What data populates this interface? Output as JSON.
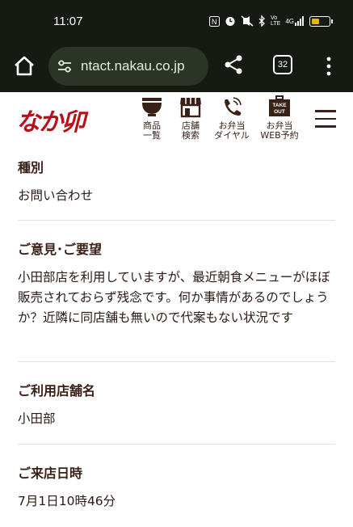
{
  "status": {
    "time": "11:07",
    "network": "4G"
  },
  "browser": {
    "url": "ntact.nakau.co.jp",
    "tab_count": "32"
  },
  "site": {
    "logo": "なか卯",
    "nav": [
      {
        "line1": "商品",
        "line2": "一覧"
      },
      {
        "line1": "店舗",
        "line2": "検索"
      },
      {
        "line1": "お弁当",
        "line2": "ダイヤル"
      },
      {
        "line1": "お弁当",
        "line2": "WEB予約"
      }
    ],
    "takeout_icon_text": [
      "TAKE",
      "OUT"
    ]
  },
  "form": {
    "type_label": "種別",
    "type_value": "お問い合わせ",
    "opinion_label": "ご意見･ご要望",
    "opinion_value": "小田部店を利用していますが、最近朝食メニューがほぼ販売されておらず残念です。何か事情があるのでしょうか？近隣に同店舗も無いので代案もない状況です",
    "store_label": "ご利用店舗名",
    "store_value": "小田部",
    "visit_label": "ご来店日時",
    "visit_value": "7月1日10時46分"
  },
  "colors": {
    "bar": "#151a12",
    "pill": "#2c3327",
    "brand_red": "#b8101a",
    "text_brown": "#3a2118",
    "battery": "#e8b800"
  },
  "battery_level": 0.45
}
